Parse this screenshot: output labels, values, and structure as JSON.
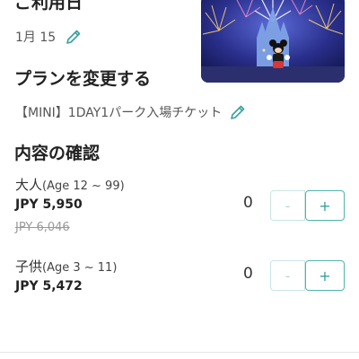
{
  "date_section": {
    "title": "ご利用日",
    "value": "1月 15",
    "edit_icon": "pencil-icon"
  },
  "hero_image": {
    "description_icon": "castle-fireworks-image"
  },
  "plan_section": {
    "title": "プランを変更する",
    "value": "【MINI】1DAY1パーク入場チケット",
    "edit_icon": "pencil-icon"
  },
  "confirm_section": {
    "title": "内容の確認",
    "tickets": [
      {
        "name": "大人",
        "age": "(Age 12 ~ 99)",
        "price": "JPY 5,950",
        "old_price": "JPY 6,046",
        "quantity": "0",
        "minus_label": "-",
        "plus_label": "+"
      },
      {
        "name": "子供",
        "age": "(Age 3 ~ 11)",
        "price": "JPY 5,472",
        "quantity": "0",
        "minus_label": "-",
        "plus_label": "+"
      }
    ]
  },
  "colors": {
    "accent": "#3aa09b",
    "accent_border": "#4fb3ae",
    "disabled_border": "#c9e6e3",
    "pencil": "#3aa09b"
  }
}
